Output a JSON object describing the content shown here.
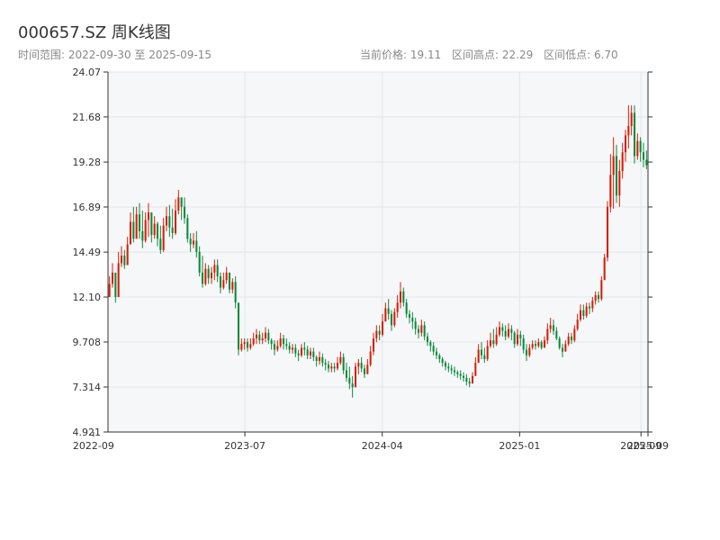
{
  "header": {
    "title": "000657.SZ 周K线图",
    "range_label": "时间范围: 2022-09-30 至 2025-09-15",
    "current_price": "当前价格: 19.11",
    "high_label": "区间高点: 22.29",
    "low_label": "区间低点: 6.70"
  },
  "colors": {
    "up": "#d81e06",
    "down": "#0c8a3c",
    "axis": "#333333",
    "grid": "#e3e6ea",
    "plot_bg": "#f6f7f9"
  },
  "chart_data": {
    "type": "candlestick",
    "ylim": [
      4.921,
      24.07
    ],
    "y_ticks": [
      "4.921",
      "7.314",
      "9.708",
      "12.10",
      "14.49",
      "16.89",
      "19.28",
      "21.68",
      "24.07"
    ],
    "xlim": [
      "2022-09-30",
      "2025-09-15"
    ],
    "x_ticks": [
      {
        "date": "2022-09-01",
        "label": "2022-09"
      },
      {
        "date": "2023-07-01",
        "label": "2023-07"
      },
      {
        "date": "2024-04-01",
        "label": "2024-04"
      },
      {
        "date": "2025-01-01",
        "label": "2025-01"
      },
      {
        "date": "2025-09-01",
        "label": "2025-09"
      },
      {
        "date": "2025-09-15",
        "label": "2025-09"
      }
    ],
    "close": [
      12.8,
      13.4,
      12.1,
      13.9,
      14.3,
      13.8,
      14.9,
      16.1,
      15.2,
      16.5,
      15.6,
      15.1,
      16.2,
      16.6,
      15.4,
      16.0,
      15.2,
      14.6,
      15.9,
      16.4,
      15.8,
      15.5,
      16.7,
      17.4,
      16.9,
      16.3,
      15.2,
      14.9,
      15.1,
      14.5,
      13.4,
      12.8,
      13.6,
      13.1,
      13.4,
      13.8,
      13.2,
      12.6,
      13.0,
      13.4,
      12.5,
      12.9,
      11.8,
      9.3,
      9.6,
      9.7,
      9.4,
      9.6,
      9.9,
      10.1,
      9.8,
      9.9,
      10.2,
      9.8,
      9.6,
      9.3,
      9.5,
      9.9,
      9.6,
      9.5,
      9.3,
      9.4,
      9.1,
      9.0,
      9.4,
      9.3,
      9.0,
      9.2,
      8.9,
      8.7,
      8.9,
      8.6,
      8.5,
      8.3,
      8.4,
      8.3,
      8.6,
      8.9,
      8.2,
      7.8,
      7.5,
      7.3,
      8.4,
      8.6,
      8.3,
      8.0,
      8.5,
      9.2,
      9.9,
      10.3,
      10.1,
      10.8,
      11.5,
      11.2,
      10.6,
      11.3,
      11.8,
      12.4,
      11.8,
      11.2,
      11.0,
      10.8,
      10.4,
      10.2,
      10.6,
      10.0,
      9.7,
      9.5,
      9.2,
      9.0,
      8.8,
      8.6,
      8.4,
      8.3,
      8.2,
      8.1,
      8.0,
      7.9,
      7.8,
      7.6,
      7.5,
      7.9,
      8.6,
      9.3,
      9.0,
      8.8,
      9.5,
      9.8,
      9.6,
      10.1,
      10.5,
      10.3,
      10.0,
      10.4,
      10.2,
      9.6,
      10.1,
      9.9,
      9.3,
      9.0,
      9.4,
      9.6,
      9.5,
      9.7,
      9.4,
      9.8,
      10.4,
      10.6,
      10.3,
      9.9,
      9.4,
      9.2,
      9.6,
      10.0,
      9.8,
      10.4,
      10.9,
      11.4,
      11.1,
      11.6,
      11.5,
      11.9,
      12.2,
      12.0,
      13.0,
      14.2,
      16.9,
      18.6,
      19.6,
      17.5,
      18.8,
      19.8,
      20.7,
      21.2,
      21.9,
      19.6,
      20.4,
      19.8,
      19.4,
      19.11
    ],
    "high": [
      13.2,
      13.9,
      12.9,
      14.5,
      14.8,
      14.6,
      15.3,
      16.6,
      16.9,
      16.9,
      17.1,
      16.7,
      16.6,
      17.1,
      16.5,
      16.4,
      16.1,
      15.9,
      16.3,
      16.9,
      17.0,
      16.8,
      17.3,
      17.8,
      17.4,
      17.4,
      16.5,
      15.5,
      15.5,
      15.6,
      14.8,
      14.3,
      13.9,
      13.8,
      13.7,
      14.1,
      14.1,
      13.4,
      13.4,
      13.7,
      13.4,
      13.1,
      13.2,
      11.6,
      9.9,
      9.9,
      9.9,
      9.9,
      10.2,
      10.4,
      10.3,
      10.2,
      10.5,
      10.4,
      9.9,
      9.8,
      9.8,
      10.2,
      10.1,
      9.9,
      9.7,
      9.6,
      9.6,
      9.3,
      9.6,
      9.7,
      9.5,
      9.4,
      9.4,
      9.0,
      9.2,
      9.1,
      8.8,
      8.7,
      8.6,
      8.6,
      8.9,
      9.2,
      9.1,
      8.6,
      8.4,
      7.9,
      8.6,
      8.8,
      8.9,
      8.5,
      8.8,
      9.5,
      10.2,
      10.6,
      10.6,
      11.2,
      11.8,
      12.0,
      11.4,
      11.5,
      12.2,
      12.9,
      12.6,
      12.0,
      11.4,
      11.3,
      11.0,
      10.6,
      10.9,
      10.8,
      10.2,
      9.8,
      9.7,
      9.4,
      9.1,
      8.9,
      8.7,
      8.6,
      8.5,
      8.4,
      8.2,
      8.2,
      8.1,
      8.0,
      7.8,
      8.1,
      8.9,
      9.6,
      9.7,
      9.4,
      9.8,
      10.2,
      10.4,
      10.5,
      10.8,
      10.7,
      10.6,
      10.7,
      10.6,
      10.3,
      10.4,
      10.3,
      10.1,
      9.6,
      9.6,
      9.8,
      9.8,
      9.9,
      9.8,
      10.0,
      10.7,
      11.0,
      10.9,
      10.5,
      10.0,
      9.6,
      9.8,
      10.2,
      10.2,
      10.6,
      11.2,
      11.7,
      11.7,
      11.8,
      11.8,
      12.1,
      12.4,
      12.4,
      13.2,
      14.4,
      17.2,
      19.7,
      20.6,
      20.2,
      19.4,
      20.3,
      21.0,
      22.3,
      22.29,
      22.29,
      20.8,
      20.6,
      20.3,
      19.9
    ],
    "low": [
      12.3,
      12.6,
      11.8,
      13.4,
      13.7,
      13.6,
      14.3,
      15.6,
      15.0,
      15.3,
      15.2,
      14.7,
      15.0,
      15.3,
      15.0,
      15.2,
      14.8,
      14.4,
      14.5,
      15.6,
      15.3,
      15.2,
      15.4,
      16.5,
      16.2,
      16.0,
      15.0,
      14.5,
      14.7,
      14.2,
      13.2,
      12.6,
      12.7,
      12.8,
      12.8,
      13.0,
      12.9,
      12.3,
      12.5,
      12.8,
      12.3,
      12.3,
      11.5,
      9.0,
      9.2,
      9.3,
      9.2,
      9.3,
      9.5,
      9.6,
      9.6,
      9.6,
      9.7,
      9.6,
      9.3,
      9.0,
      9.2,
      9.4,
      9.3,
      9.3,
      9.1,
      9.1,
      8.9,
      8.7,
      8.9,
      9.0,
      8.8,
      8.8,
      8.7,
      8.4,
      8.5,
      8.4,
      8.2,
      8.1,
      8.1,
      8.1,
      8.2,
      8.5,
      8.0,
      7.6,
      7.2,
      6.75,
      7.4,
      8.0,
      8.1,
      7.8,
      8.0,
      8.4,
      9.0,
      9.7,
      9.8,
      10.0,
      10.8,
      10.9,
      10.3,
      10.5,
      11.0,
      11.5,
      11.6,
      11.0,
      10.7,
      10.4,
      10.1,
      9.9,
      10.0,
      9.8,
      9.5,
      9.2,
      9.0,
      8.8,
      8.6,
      8.4,
      8.2,
      8.1,
      8.0,
      7.9,
      7.8,
      7.7,
      7.6,
      7.4,
      7.3,
      7.5,
      7.9,
      8.7,
      8.8,
      8.6,
      8.7,
      9.4,
      9.4,
      9.5,
      10.0,
      10.0,
      9.8,
      9.9,
      9.8,
      9.4,
      9.5,
      9.5,
      9.1,
      8.7,
      8.9,
      9.3,
      9.3,
      9.4,
      9.3,
      9.4,
      9.6,
      10.2,
      10.1,
      9.8,
      9.3,
      8.9,
      9.2,
      9.5,
      9.6,
      9.7,
      10.3,
      10.8,
      10.9,
      11.0,
      11.2,
      11.3,
      11.7,
      11.8,
      11.9,
      13.2,
      14.0,
      16.6,
      16.8,
      17.1,
      16.9,
      18.4,
      19.3,
      20.0,
      20.7,
      19.2,
      19.4,
      19.3,
      19.0,
      18.9
    ]
  }
}
